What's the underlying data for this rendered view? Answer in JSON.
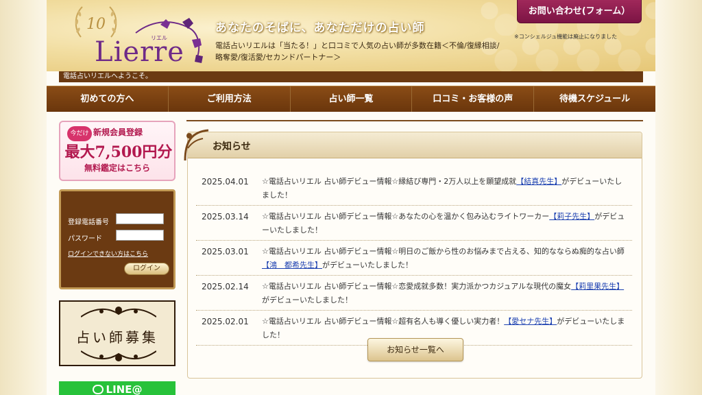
{
  "header": {
    "brand": "Lierre",
    "brand_kana": "リエル",
    "anniversary": "10",
    "tagline": "あなたのそばに、あなただけの占い師",
    "intro": "電話占いリエルは「当たる！」と口コミで人気の占い師が多数在籍＜不倫/復縁相談/略奪愛/復活愛/セカンドパートナー＞",
    "contact_button": "お問い合わせ(フォーム）",
    "concierge_note": "※コンシェルジュ機能は廃止になりました",
    "welcome": "電話占いリエルへようこそ。"
  },
  "nav": {
    "items": [
      "初めての方へ",
      "ご利用方法",
      "占い師一覧",
      "口コミ・お客様の声",
      "待機スケジュール"
    ]
  },
  "sidebar": {
    "register_banner": {
      "tag": "今だけ",
      "line1": "新規会員登録",
      "line2": "最大7,500円分",
      "line3": "無料鑑定はこちら"
    },
    "login": {
      "phone_label": "登録電話番号",
      "password_label": "パスワード",
      "forgot_link": "ログインできない方はこちら",
      "login_button": "ログイン"
    },
    "recruit": "占い師募集",
    "line": "LINE@"
  },
  "news": {
    "title": "お知らせ",
    "items": [
      {
        "date": "2025.04.01",
        "pre": "☆電話占いリエル 占い師デビュー情報☆縁結び専門・2万人以上を願望成就",
        "link": "【結真先生】",
        "post": "がデビューいたしました！"
      },
      {
        "date": "2025.03.14",
        "pre": "☆電話占いリエル 占い師デビュー情報☆あなたの心を温かく包み込むライトワーカー",
        "link": "【莉子先生】",
        "post": "がデビューいたしました！"
      },
      {
        "date": "2025.03.01",
        "pre": "☆電話占いリエル 占い師デビュー情報☆明日のご飯から性のお悩みまで占える、知的なならぬ痴的な占い師",
        "link": "【鴻　都希先生】",
        "post": "がデビューいたしました！"
      },
      {
        "date": "2025.02.14",
        "pre": "☆電話占いリエル 占い師デビュー情報☆恋愛成就多数！実力派かつカジュアルな現代の魔女",
        "link": "【莉里果先生】",
        "post": "がデビューいたしました！"
      },
      {
        "date": "2025.02.01",
        "pre": "☆電話占いリエル 占い師デビュー情報☆超有名人も導く優しい実力者！",
        "link": "【愛セナ先生】",
        "post": "がデビューいたしました！"
      }
    ],
    "more_button": "お知らせ一覧へ"
  },
  "colors": {
    "brown": "#6b3a12",
    "gold": "#e6c777",
    "purple": "#6e2a88",
    "contact": "#8c1c4e",
    "link": "#1a3fb0"
  }
}
